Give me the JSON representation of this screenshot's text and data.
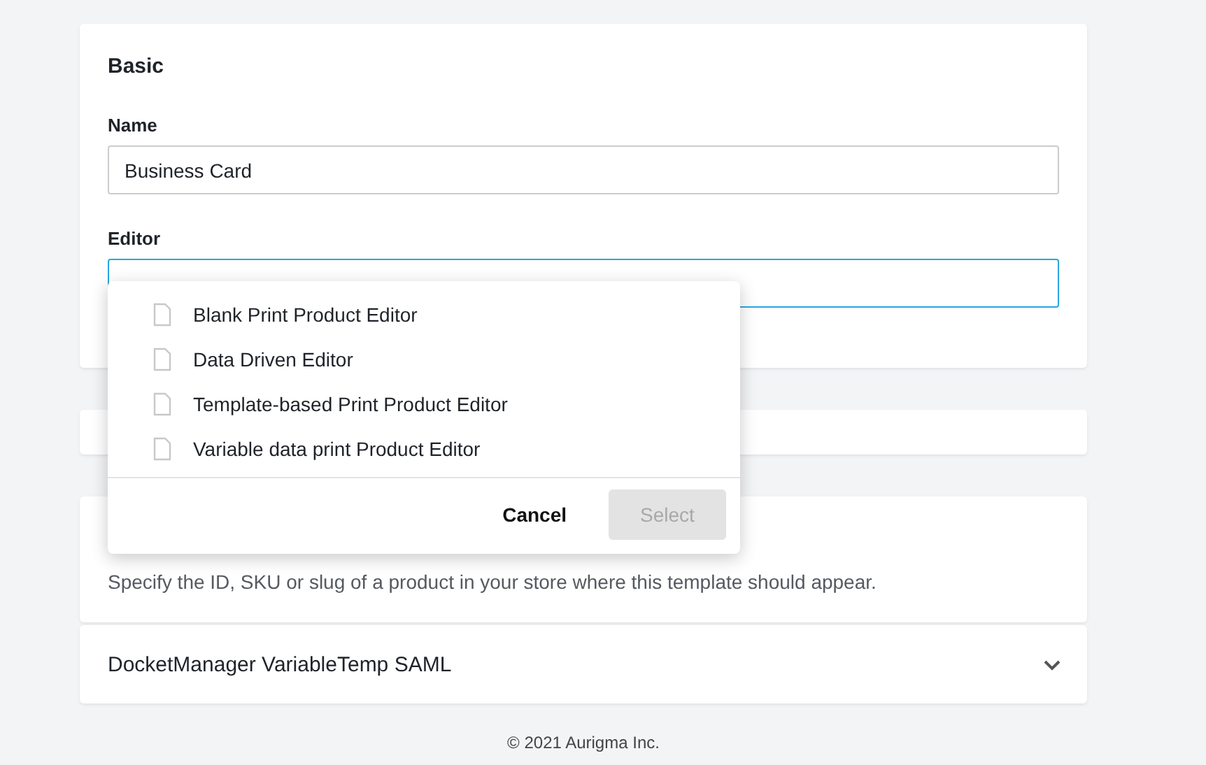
{
  "sections": [
    {
      "kind": "form",
      "title": "Basic",
      "fields": [
        {
          "label": "Name",
          "value": "Business Card",
          "focused": false
        },
        {
          "label": "Editor",
          "focused": true
        }
      ]
    },
    {
      "kind": "blank"
    },
    {
      "kind": "text",
      "text": "Specify the ID, SKU or slug of a product in your store where this template should appear."
    },
    {
      "kind": "collapsible",
      "title": "DocketManager VariableTemp SAML",
      "expanded": false
    }
  ],
  "editor_menu": {
    "items": [
      {
        "label": "Blank Print Product Editor"
      },
      {
        "label": "Data Driven Editor"
      },
      {
        "label": "Template-based Print Product Editor"
      },
      {
        "label": "Variable data print Product Editor"
      }
    ],
    "buttons": [
      {
        "label": "Cancel",
        "disabled": false
      },
      {
        "label": "Select",
        "disabled": true
      }
    ]
  },
  "footer": [
    "© 2021 Aurigma Inc."
  ]
}
